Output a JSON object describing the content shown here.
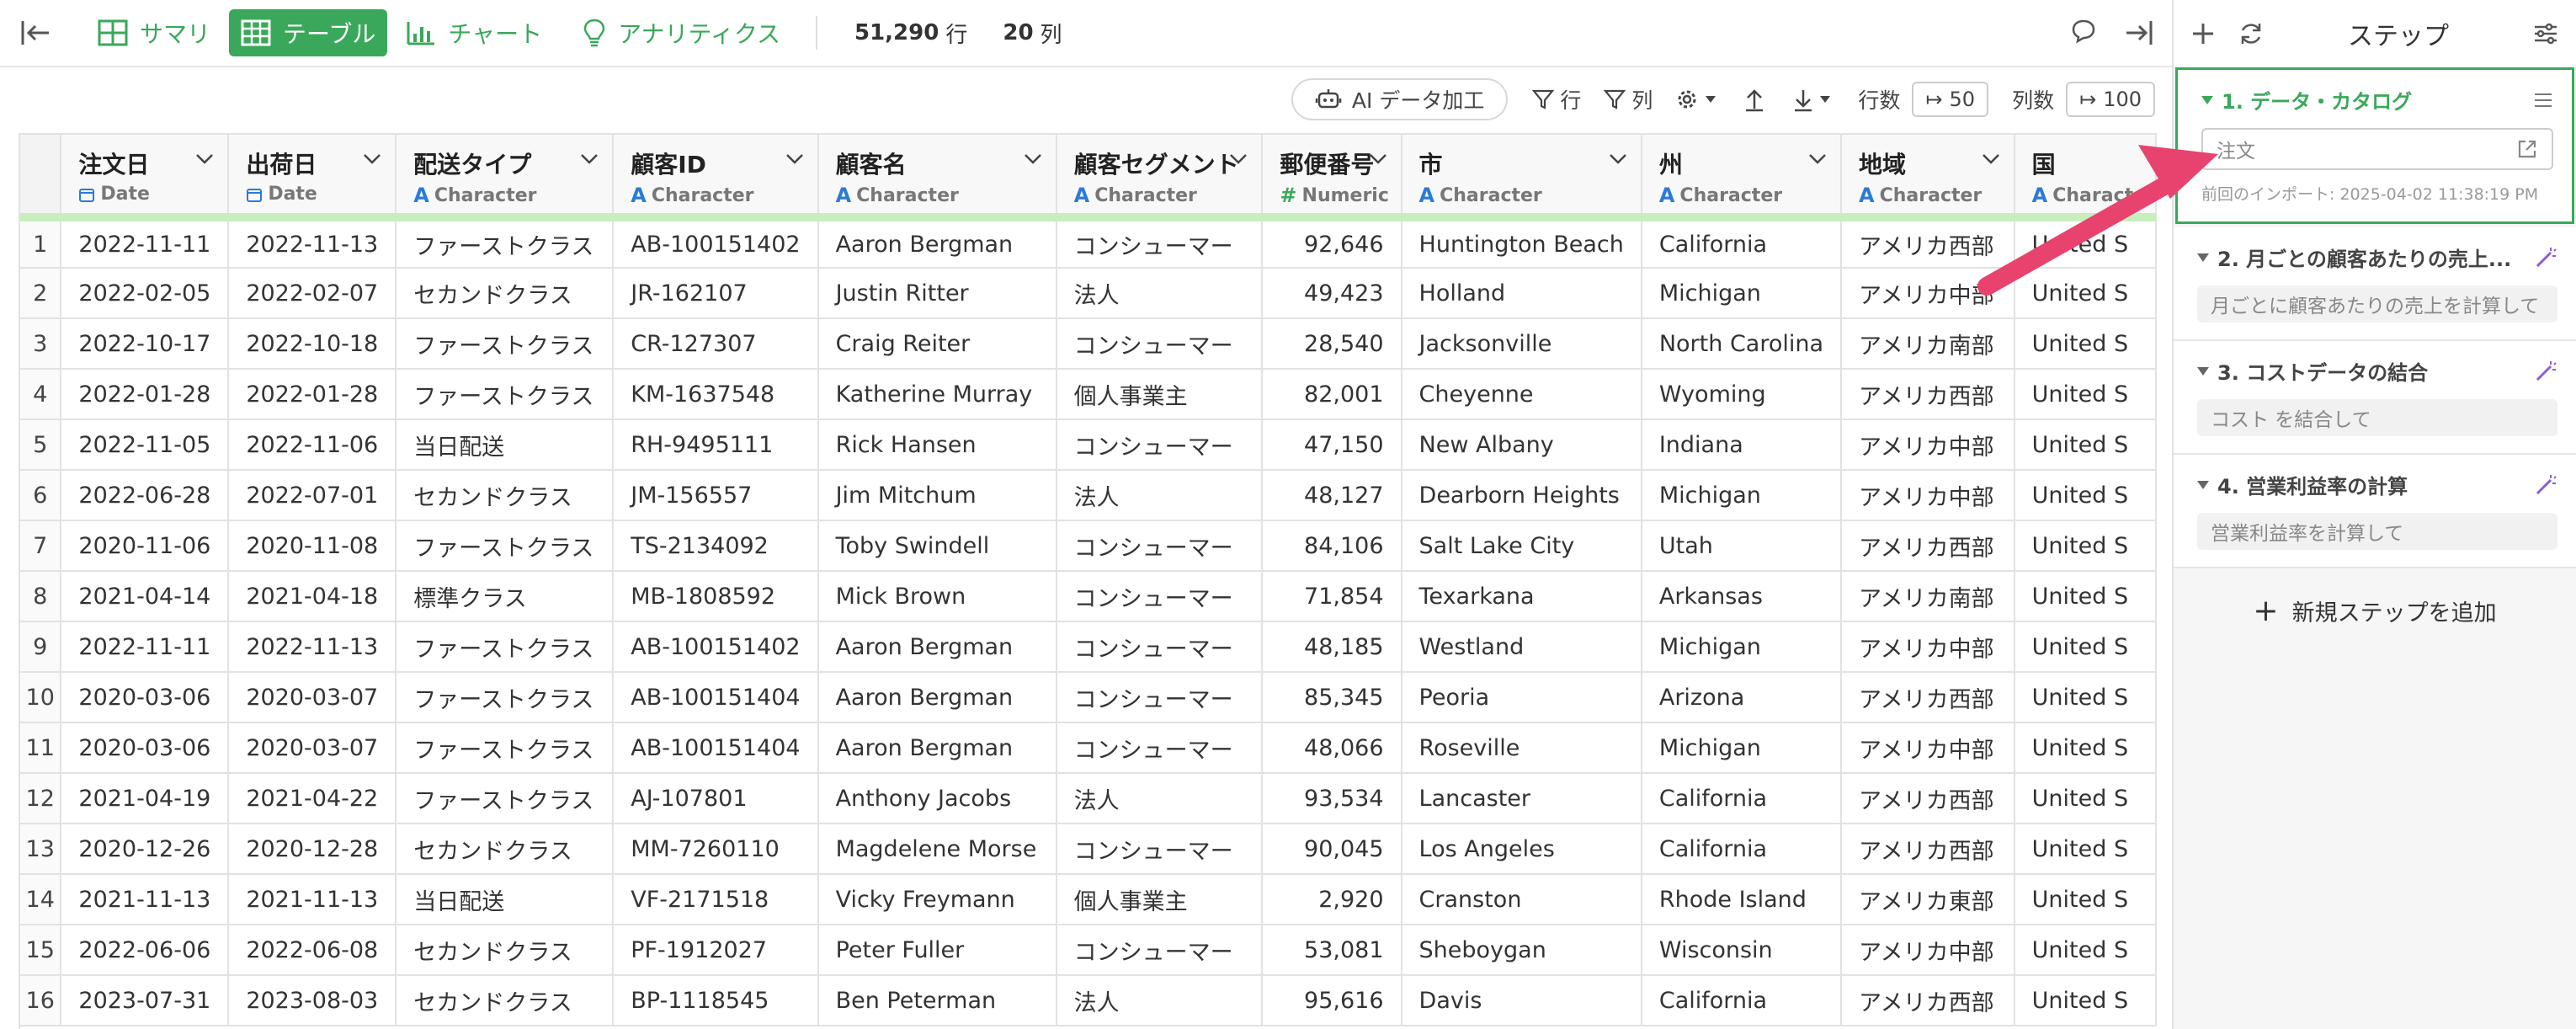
{
  "toolbar": {
    "tabs": [
      {
        "label": "サマリ",
        "icon": "summary-grid-icon"
      },
      {
        "label": "テーブル",
        "icon": "table-icon"
      },
      {
        "label": "チャート",
        "icon": "bar-chart-icon"
      },
      {
        "label": "アナリティクス",
        "icon": "lightbulb-icon"
      }
    ],
    "rows_value": "51,290",
    "rows_unit": "行",
    "cols_value": "20",
    "cols_unit": "列"
  },
  "subbar": {
    "ai_label": "AI データ加工",
    "row_filter": "行",
    "col_filter": "列",
    "rows_label": "行数",
    "rows_count": "50",
    "cols_label": "列数",
    "cols_count": "100"
  },
  "table": {
    "columns": [
      {
        "name": "注文日",
        "type": "Date",
        "icon": "calendar-icon"
      },
      {
        "name": "出荷日",
        "type": "Date",
        "icon": "calendar-icon"
      },
      {
        "name": "配送タイプ",
        "type": "Character",
        "icon": "character-icon"
      },
      {
        "name": "顧客ID",
        "type": "Character",
        "icon": "character-icon"
      },
      {
        "name": "顧客名",
        "type": "Character",
        "icon": "character-icon"
      },
      {
        "name": "顧客セグメント",
        "type": "Character",
        "icon": "character-icon"
      },
      {
        "name": "郵便番号",
        "type": "Numeric",
        "icon": "numeric-icon"
      },
      {
        "name": "市",
        "type": "Character",
        "icon": "character-icon"
      },
      {
        "name": "州",
        "type": "Character",
        "icon": "character-icon"
      },
      {
        "name": "地域",
        "type": "Character",
        "icon": "character-icon"
      },
      {
        "name": "国",
        "type": "Character",
        "icon": "character-icon"
      }
    ],
    "rows": [
      [
        "1",
        "2022-11-11",
        "2022-11-13",
        "ファーストクラス",
        "AB-100151402",
        "Aaron Bergman",
        "コンシューマー",
        "92,646",
        "Huntington Beach",
        "California",
        "アメリカ西部",
        "United S"
      ],
      [
        "2",
        "2022-02-05",
        "2022-02-07",
        "セカンドクラス",
        "JR-162107",
        "Justin Ritter",
        "法人",
        "49,423",
        "Holland",
        "Michigan",
        "アメリカ中部",
        "United S"
      ],
      [
        "3",
        "2022-10-17",
        "2022-10-18",
        "ファーストクラス",
        "CR-127307",
        "Craig Reiter",
        "コンシューマー",
        "28,540",
        "Jacksonville",
        "North Carolina",
        "アメリカ南部",
        "United S"
      ],
      [
        "4",
        "2022-01-28",
        "2022-01-28",
        "ファーストクラス",
        "KM-1637548",
        "Katherine Murray",
        "個人事業主",
        "82,001",
        "Cheyenne",
        "Wyoming",
        "アメリカ西部",
        "United S"
      ],
      [
        "5",
        "2022-11-05",
        "2022-11-06",
        "当日配送",
        "RH-9495111",
        "Rick Hansen",
        "コンシューマー",
        "47,150",
        "New Albany",
        "Indiana",
        "アメリカ中部",
        "United S"
      ],
      [
        "6",
        "2022-06-28",
        "2022-07-01",
        "セカンドクラス",
        "JM-156557",
        "Jim Mitchum",
        "法人",
        "48,127",
        "Dearborn Heights",
        "Michigan",
        "アメリカ中部",
        "United S"
      ],
      [
        "7",
        "2020-11-06",
        "2020-11-08",
        "ファーストクラス",
        "TS-2134092",
        "Toby Swindell",
        "コンシューマー",
        "84,106",
        "Salt Lake City",
        "Utah",
        "アメリカ西部",
        "United S"
      ],
      [
        "8",
        "2021-04-14",
        "2021-04-18",
        "標準クラス",
        "MB-1808592",
        "Mick Brown",
        "コンシューマー",
        "71,854",
        "Texarkana",
        "Arkansas",
        "アメリカ南部",
        "United S"
      ],
      [
        "9",
        "2022-11-11",
        "2022-11-13",
        "ファーストクラス",
        "AB-100151402",
        "Aaron Bergman",
        "コンシューマー",
        "48,185",
        "Westland",
        "Michigan",
        "アメリカ中部",
        "United S"
      ],
      [
        "10",
        "2020-03-06",
        "2020-03-07",
        "ファーストクラス",
        "AB-100151404",
        "Aaron Bergman",
        "コンシューマー",
        "85,345",
        "Peoria",
        "Arizona",
        "アメリカ西部",
        "United S"
      ],
      [
        "11",
        "2020-03-06",
        "2020-03-07",
        "ファーストクラス",
        "AB-100151404",
        "Aaron Bergman",
        "コンシューマー",
        "48,066",
        "Roseville",
        "Michigan",
        "アメリカ中部",
        "United S"
      ],
      [
        "12",
        "2021-04-19",
        "2021-04-22",
        "ファーストクラス",
        "AJ-107801",
        "Anthony Jacobs",
        "法人",
        "93,534",
        "Lancaster",
        "California",
        "アメリカ西部",
        "United S"
      ],
      [
        "13",
        "2020-12-26",
        "2020-12-28",
        "セカンドクラス",
        "MM-7260110",
        "Magdelene Morse",
        "コンシューマー",
        "90,045",
        "Los Angeles",
        "California",
        "アメリカ西部",
        "United S"
      ],
      [
        "14",
        "2021-11-13",
        "2021-11-13",
        "当日配送",
        "VF-2171518",
        "Vicky Freymann",
        "個人事業主",
        "2,920",
        "Cranston",
        "Rhode Island",
        "アメリカ東部",
        "United S"
      ],
      [
        "15",
        "2022-06-06",
        "2022-06-08",
        "セカンドクラス",
        "PF-1912027",
        "Peter Fuller",
        "コンシューマー",
        "53,081",
        "Sheboygan",
        "Wisconsin",
        "アメリカ中部",
        "United S"
      ],
      [
        "16",
        "2023-07-31",
        "2023-08-03",
        "セカンドクラス",
        "BP-1118545",
        "Ben Peterman",
        "法人",
        "95,616",
        "Davis",
        "California",
        "アメリカ西部",
        "United S"
      ]
    ]
  },
  "panel": {
    "title": "ステップ",
    "steps": [
      {
        "title": "1. データ・カタログ",
        "body": "注文",
        "note": "前回のインポート: 2025-04-02 11:38:19 PM"
      },
      {
        "title": "2. 月ごとの顧客あたりの売上...",
        "body": "月ごとに顧客あたりの売上を計算して"
      },
      {
        "title": "3. コストデータの結合",
        "body": "コスト を結合して"
      },
      {
        "title": "4. 営業利益率の計算",
        "body": "営業利益率を計算して"
      }
    ],
    "add_step": "新規ステップを追加"
  },
  "colors": {
    "accent": "#3aa85a",
    "arrow": "#e8436e",
    "magic": "#8a5cd6"
  }
}
